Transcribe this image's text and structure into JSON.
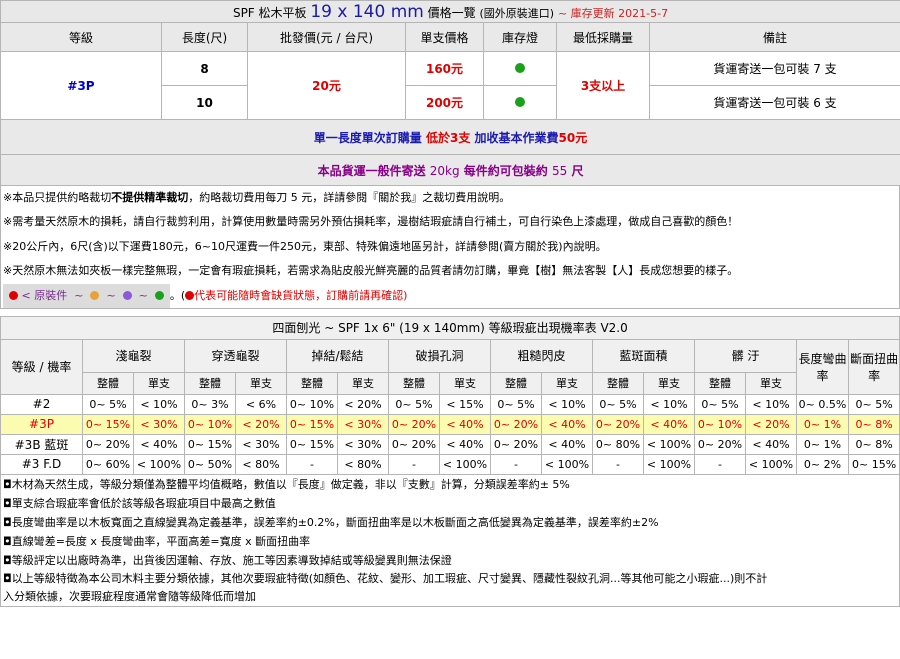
{
  "title": {
    "prefix": "SPF 松木平板",
    "size": "19 x 140 mm",
    "suffix": "價格一覽",
    "origin": "(國外原裝進口)",
    "updated": "~ 庫存更新 2021-5-7"
  },
  "price_table": {
    "headers": [
      "等級",
      "長度(尺)",
      "批發價(元 / 台尺)",
      "單支價格",
      "庫存燈",
      "最低採購量",
      "備註"
    ],
    "grade": "#3P",
    "wholesale_price": "20元",
    "min_order": "3支以上",
    "rows": [
      {
        "length": "8",
        "unit_price": "160元",
        "stock_color": "#1aa01a",
        "note": "貨運寄送一包可裝 7 支"
      },
      {
        "length": "10",
        "unit_price": "200元",
        "stock_color": "#1aa01a",
        "note": "貨運寄送一包可裝 6 支"
      }
    ],
    "banner1": {
      "a": "單一長度單次訂購量 ",
      "b": "低於3支",
      "c": " 加收基本作業費",
      "d": "50元"
    },
    "banner2": {
      "a": "本品貨運一般件寄送 ",
      "b": "20kg",
      "c": " 每件約可包裝約 ",
      "d": "55",
      "e": " 尺"
    }
  },
  "notes_top": {
    "line1_a": "※本品只提供約略裁切",
    "line1_b": "不提供精準裁切",
    "line1_c": "，約略裁切費用每刀 5 元，詳請參閱『關於我』之裁切費用說明。",
    "line2": "※需考量天然原木的損耗，請自行裁剪利用，計算使用數量時需另外預估損耗率，邊樹結瑕疵請自行補土，可自行染色上漆處理，做成自己喜歡的顏色！",
    "line3": "※20公斤內，6尺(含)以下運費180元，6~10尺運費一件250元，東部、特殊偏遠地區另計，詳請參閱(賣方關於我)內說明。",
    "line4": "※天然原木無法如夾板一樣完整無瑕，一定會有瑕疵損耗，若需求為貼皮般光鮮亮麗的品質者請勿訂購，畢竟【樹】無法客製【人】長成您想要的樣子。",
    "legend_label": "< 原裝件",
    "legend_sep": "~",
    "legend_colors": [
      "#e00000",
      "#e8a23a",
      "#8a5ad8",
      "#1aa01a"
    ],
    "legend_end": "。(",
    "legend_warn": "代表可能隨時會缺貨狀態，訂購前請再確認)"
  },
  "defect_table": {
    "title": "四面刨光 ~ SPF 1x 6\"  (19 x 140mm) 等級瑕疵出現機率表 V2.0",
    "row_header": "等級 / 機率",
    "groups": [
      "淺龜裂",
      "穿透龜裂",
      "掉結/鬆結",
      "破損孔洞",
      "粗糙閃皮",
      "藍斑面積",
      "髒 汙"
    ],
    "extra_cols": [
      "長度彎曲率",
      "斷面扭曲率"
    ],
    "sub": [
      "整體",
      "單支"
    ],
    "rows": [
      {
        "grade": "#2",
        "values": [
          "0~ 5%",
          "< 10%",
          "0~ 3%",
          "< 6%",
          "0~ 10%",
          "< 20%",
          "0~ 5%",
          "< 15%",
          "0~ 5%",
          "< 10%",
          "0~ 5%",
          "< 10%",
          "0~ 5%",
          "< 10%",
          "0~ 0.5%",
          "0~ 5%"
        ]
      },
      {
        "grade": "#3P",
        "values": [
          "0~ 15%",
          "< 30%",
          "0~ 10%",
          "< 20%",
          "0~ 15%",
          "< 30%",
          "0~ 20%",
          "< 40%",
          "0~ 20%",
          "< 40%",
          "0~ 20%",
          "< 40%",
          "0~ 10%",
          "< 20%",
          "0~ 1%",
          "0~ 8%"
        ]
      },
      {
        "grade": "#3B 藍斑",
        "values": [
          "0~ 20%",
          "< 40%",
          "0~ 15%",
          "< 30%",
          "0~ 15%",
          "< 30%",
          "0~ 20%",
          "< 40%",
          "0~ 20%",
          "< 40%",
          "0~ 80%",
          "< 100%",
          "0~ 20%",
          "< 40%",
          "0~ 1%",
          "0~ 8%"
        ]
      },
      {
        "grade": "#3 F.D",
        "values": [
          "0~ 60%",
          "< 100%",
          "0~ 50%",
          "< 80%",
          "-",
          "< 80%",
          "-",
          "< 100%",
          "-",
          "< 100%",
          "-",
          "< 100%",
          "-",
          "< 100%",
          "0~ 2%",
          "0~ 15%"
        ]
      }
    ]
  },
  "notes_bottom": [
    "◘木材為天然生成，等級分類僅為整體平均值概略，數值以『長度』做定義，非以『支數』計算，分類誤差率約± 5%",
    "◘單支綜合瑕疵率會低於該等級各瑕疵項目中最高之數值",
    "◘長度彎曲率是以木板寬面之直線變異為定義基準，誤差率約±0.2%，斷面扭曲率是以木板斷面之高低變異為定義基準，誤差率約±2%",
    "◘直線彎差=長度 x 長度彎曲率，平面高差=寬度 x 斷面扭曲率",
    "◘等級評定以出廠時為準，出貨後因運輸、存放、施工等因素導致掉結或等級變異則無法保證",
    "◘以上等級特徵為本公司木料主要分類依據，其他次要瑕疵特徵(如顏色、花紋、變形、加工瑕疵、尺寸變異、隱藏性裂紋孔洞...等其他可能之小瑕疵...)則不計",
    "入分類依據，次要瑕疵程度通常會隨等級降低而增加"
  ]
}
